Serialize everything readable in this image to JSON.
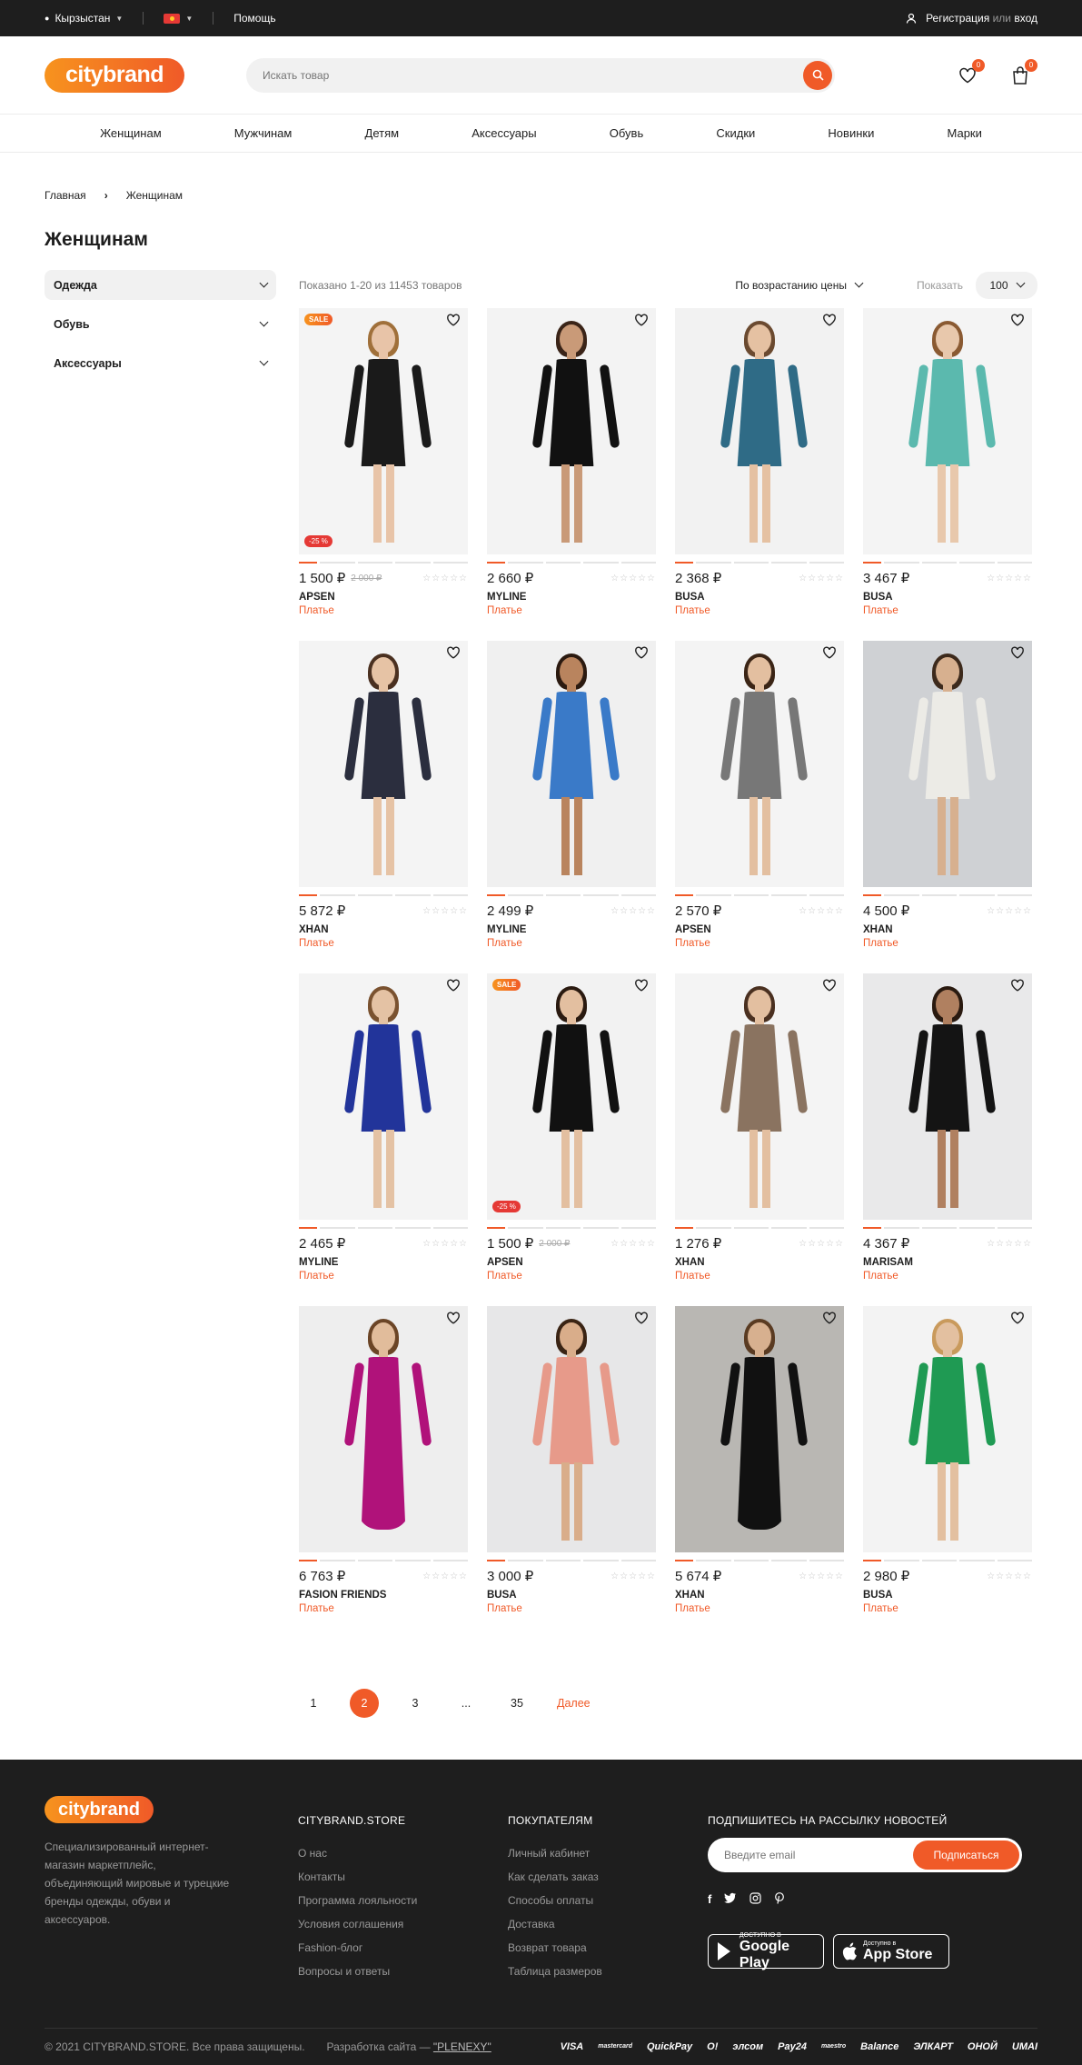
{
  "topbar": {
    "country": "Кырзыстан",
    "help": "Помощь",
    "register": "Регистрация",
    "or": "или",
    "login": "вход"
  },
  "header": {
    "logo": "citybrand",
    "search_placeholder": "Искать товар",
    "favorites_count": "0",
    "cart_count": "0"
  },
  "nav": [
    "Женщинам",
    "Мужчинам",
    "Детям",
    "Аксессуары",
    "Обувь",
    "Скидки",
    "Новинки",
    "Марки"
  ],
  "breadcrumb": [
    "Главная",
    "Женщинам"
  ],
  "page_title": "Женщинам",
  "sidebar": [
    "Одежда",
    "Обувь",
    "Аксессуары"
  ],
  "toolbar": {
    "count": "Показано 1-20 из 11453 товаров",
    "sort": "По возрастанию цены",
    "show_label": "Показать",
    "show_value": "100"
  },
  "products": [
    {
      "price": "1 500 ₽",
      "old": "2 000 ₽",
      "brand": "APSEN",
      "type": "Платье",
      "sale": "SALE",
      "disc": "-25 %",
      "dress": "#1a1a1a",
      "bg": "#f4f4f4",
      "skin": "#e8c4a8",
      "hair": "#a0703a"
    },
    {
      "price": "2 660 ₽",
      "old": "",
      "brand": "MYLINE",
      "type": "Платье",
      "sale": "",
      "disc": "",
      "dress": "#111111",
      "bg": "#f3f3f3",
      "skin": "#c99a78",
      "hair": "#3a2418"
    },
    {
      "price": "2 368 ₽",
      "old": "",
      "brand": "BUSA",
      "type": "Платье",
      "sale": "",
      "disc": "",
      "dress": "#2f6b86",
      "bg": "#f2f2f2",
      "skin": "#e5c1a2",
      "hair": "#6b4a30"
    },
    {
      "price": "3 467 ₽",
      "old": "",
      "brand": "BUSA",
      "type": "Платье",
      "sale": "",
      "disc": "",
      "dress": "#5bb9ae",
      "bg": "#f4f4f4",
      "skin": "#e8c8ac",
      "hair": "#8a5a32"
    },
    {
      "price": "5 872 ₽",
      "old": "",
      "brand": "XHAN",
      "type": "Платье",
      "sale": "",
      "disc": "",
      "dress": "#2b2e3e",
      "bg": "#f4f4f4",
      "skin": "#e6c3a5",
      "hair": "#4a3020"
    },
    {
      "price": "2 499 ₽",
      "old": "",
      "brand": "MYLINE",
      "type": "Платье",
      "sale": "",
      "disc": "",
      "dress": "#3a7ac8",
      "bg": "#f0f0f0",
      "skin": "#b9845e",
      "hair": "#2b1a10"
    },
    {
      "price": "2 570 ₽",
      "old": "",
      "brand": "APSEN",
      "type": "Платье",
      "sale": "",
      "disc": "",
      "dress": "#777777",
      "bg": "#f4f4f4",
      "skin": "#e3bfa0",
      "hair": "#3b2516"
    },
    {
      "price": "4 500 ₽",
      "old": "",
      "brand": "XHAN",
      "type": "Платье",
      "sale": "",
      "disc": "",
      "dress": "#ecebe6",
      "bg": "#cfd1d4",
      "skin": "#d7b08f",
      "hair": "#3d2a1c"
    },
    {
      "price": "2 465 ₽",
      "old": "",
      "brand": "MYLINE",
      "type": "Платье",
      "sale": "",
      "disc": "",
      "dress": "#22349a",
      "bg": "#f4f4f4",
      "skin": "#e4c2a4",
      "hair": "#7a5230"
    },
    {
      "price": "1 500 ₽",
      "old": "2 000 ₽",
      "brand": "APSEN",
      "type": "Платье",
      "sale": "SALE",
      "disc": "-25 %",
      "dress": "#111111",
      "bg": "#f2f2f2",
      "skin": "#e3bfa0",
      "hair": "#2a1a10"
    },
    {
      "price": "1 276 ₽",
      "old": "",
      "brand": "XHAN",
      "type": "Платье",
      "sale": "",
      "disc": "",
      "dress": "#8a7360",
      "bg": "#f4f4f4",
      "skin": "#e3bfa0",
      "hair": "#4a3020"
    },
    {
      "price": "4 367 ₽",
      "old": "",
      "brand": "MARISAM",
      "type": "Платье",
      "sale": "",
      "disc": "",
      "dress": "#141414",
      "bg": "#e9e9ea",
      "skin": "#b08060",
      "hair": "#2a1a10"
    },
    {
      "price": "6 763 ₽",
      "old": "",
      "brand": "FASION FRIENDS",
      "type": "Платье",
      "sale": "",
      "disc": "",
      "dress": "#b0127a",
      "bg": "#eeeeee",
      "skin": "#e1bc9b",
      "hair": "#6b4526"
    },
    {
      "price": "3 000 ₽",
      "old": "",
      "brand": "BUSA",
      "type": "Платье",
      "sale": "",
      "disc": "",
      "dress": "#e79a8a",
      "bg": "#e7e7e8",
      "skin": "#d9ad8a",
      "hair": "#3a2414"
    },
    {
      "price": "5 674 ₽",
      "old": "",
      "brand": "XHAN",
      "type": "Платье",
      "sale": "",
      "disc": "",
      "dress": "#111111",
      "bg": "#b9b7b3",
      "skin": "#d7b08f",
      "hair": "#5a3b22"
    },
    {
      "price": "2 980 ₽",
      "old": "",
      "brand": "BUSA",
      "type": "Платье",
      "sale": "",
      "disc": "",
      "dress": "#1f9a53",
      "bg": "#f3f3f3",
      "skin": "#e3c0a0",
      "hair": "#c99a5c"
    }
  ],
  "pagination": {
    "pages": [
      "1",
      "2",
      "3",
      "...",
      "35"
    ],
    "current": "2",
    "next": "Далее"
  },
  "footer": {
    "logo": "citybrand",
    "description": "Специализированный интернет-магазин маркетплейс, объединяющий мировые и турецкие бренды одежды, обуви и аксессуаров.",
    "col1_title": "CITYBRAND.STORE",
    "col1_links": [
      "О нас",
      "Контакты",
      "Программа лояльности",
      "Условия соглашения",
      "Fashion-блог",
      "Вопросы и ответы"
    ],
    "col2_title": "ПОКУПАТЕЛЯМ",
    "col2_links": [
      "Личный кабинет",
      "Как сделать заказ",
      "Способы оплаты",
      "Доставка",
      "Возврат товара",
      "Таблица размеров"
    ],
    "subscribe_title": "ПОДПИШИТЕСЬ НА РАССЫЛКУ НОВОСТЕЙ",
    "email_placeholder": "Введите email",
    "subscribe_button": "Подписаться",
    "google_small": "ДОСТУПНО В",
    "google_big": "Google Play",
    "apple_small": "Доступно в",
    "apple_big": "App Store",
    "copyright": "© 2021 CITYBRAND.STORE. Все права защищены.",
    "dev_prefix": "Разработка сайта  — ",
    "dev_link": "\"PLENEXY\"",
    "payments": [
      "VISA",
      "mastercard",
      "QuickPay",
      "O!",
      "элсом",
      "Pay24",
      "maestro",
      "Balance",
      "ЭЛКАРТ",
      "ОНОЙ",
      "UMAI"
    ]
  }
}
